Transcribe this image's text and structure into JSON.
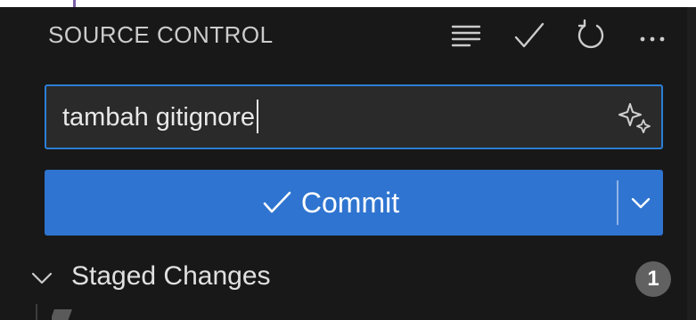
{
  "panel": {
    "title": "SOURCE CONTROL",
    "actions": [
      {
        "name": "view-as-tree-icon"
      },
      {
        "name": "commit-check-icon"
      },
      {
        "name": "refresh-icon"
      },
      {
        "name": "more-actions-icon"
      }
    ]
  },
  "commit_input": {
    "value": "tambah gitignore",
    "sparkle_icon": "sparkle-icon"
  },
  "commit_button": {
    "label": "Commit",
    "check_icon": "check-icon",
    "dropdown_icon": "chevron-down-icon"
  },
  "staged_changes": {
    "label": "Staged Changes",
    "count": "1",
    "chevron_icon": "chevron-down-icon"
  },
  "colors": {
    "background": "#181818",
    "input_border": "#2b7fd6",
    "button": "#2f74d0",
    "badge": "#616161"
  }
}
